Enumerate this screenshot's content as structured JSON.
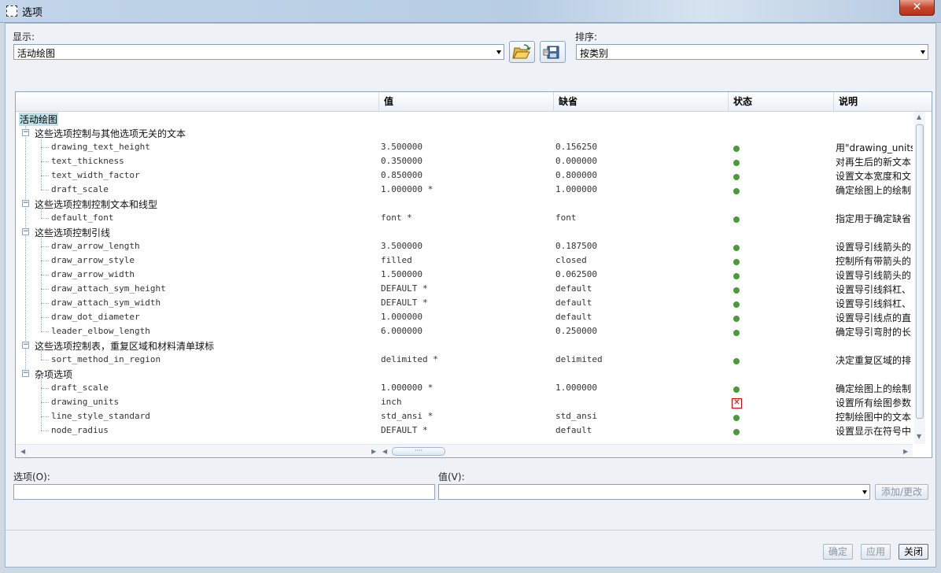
{
  "window": {
    "title": "选项",
    "close_glyph": "✕"
  },
  "display": {
    "label": "显示:",
    "value": "活动绘图"
  },
  "sort": {
    "label": "排序:",
    "value": "按类别"
  },
  "toolbar": {
    "open_icon": "folder-open-icon",
    "save_icon": "save-config-icon"
  },
  "table": {
    "columns": [
      "",
      "值",
      "缺省",
      "状态",
      "说明"
    ],
    "root": "活动绘图",
    "rows": [
      {
        "type": "group",
        "name": "这些选项控制与其他选项无关的文本"
      },
      {
        "type": "item",
        "name": "drawing_text_height",
        "value": "3.500000",
        "default": "0.156250",
        "status": "ok",
        "desc": "用\"drawing_units\""
      },
      {
        "type": "item",
        "name": "text_thickness",
        "value": "0.350000",
        "default": "0.000000",
        "status": "ok",
        "desc": "对再生后的新文本"
      },
      {
        "type": "item",
        "name": "text_width_factor",
        "value": "0.850000",
        "default": "0.800000",
        "status": "ok",
        "desc": "设置文本宽度和文"
      },
      {
        "type": "item",
        "name": "draft_scale",
        "value": "1.000000 *",
        "default": "1.000000",
        "status": "ok",
        "desc": "确定绘图上的绘制"
      },
      {
        "type": "group",
        "name": "这些选项控制控制文本和线型"
      },
      {
        "type": "item",
        "name": "default_font",
        "value": "font *",
        "default": "font",
        "status": "ok",
        "desc": "指定用于确定缺省"
      },
      {
        "type": "group",
        "name": "这些选项控制引线"
      },
      {
        "type": "item",
        "name": "draw_arrow_length",
        "value": "3.500000",
        "default": "0.187500",
        "status": "ok",
        "desc": "设置导引线箭头的"
      },
      {
        "type": "item",
        "name": "draw_arrow_style",
        "value": "filled",
        "default": "closed",
        "status": "ok",
        "desc": "控制所有带箭头的"
      },
      {
        "type": "item",
        "name": "draw_arrow_width",
        "value": "1.500000",
        "default": "0.062500",
        "status": "ok",
        "desc": "设置导引线箭头的"
      },
      {
        "type": "item",
        "name": "draw_attach_sym_height",
        "value": "DEFAULT *",
        "default": "default",
        "status": "ok",
        "desc": "设置导引线斜杠、"
      },
      {
        "type": "item",
        "name": "draw_attach_sym_width",
        "value": "DEFAULT *",
        "default": "default",
        "status": "ok",
        "desc": "设置导引线斜杠、"
      },
      {
        "type": "item",
        "name": "draw_dot_diameter",
        "value": "1.000000",
        "default": "default",
        "status": "ok",
        "desc": "设置导引线点的直"
      },
      {
        "type": "item",
        "name": "leader_elbow_length",
        "value": "6.000000",
        "default": "0.250000",
        "status": "ok",
        "desc": "确定导引弯肘的长"
      },
      {
        "type": "group",
        "name": "这些选项控制表，重复区域和材料清单球标"
      },
      {
        "type": "item",
        "name": "sort_method_in_region",
        "value": "delimited *",
        "default": "delimited",
        "status": "ok",
        "desc": "决定重复区域的排"
      },
      {
        "type": "group",
        "name": "杂项选项"
      },
      {
        "type": "item",
        "name": "draft_scale",
        "value": "1.000000 *",
        "default": "1.000000",
        "status": "ok",
        "desc": "确定绘图上的绘制"
      },
      {
        "type": "item",
        "name": "drawing_units",
        "value": "inch",
        "default": "",
        "status": "error",
        "desc": "设置所有绘图参数"
      },
      {
        "type": "item",
        "name": "line_style_standard",
        "value": "std_ansi *",
        "default": "std_ansi",
        "status": "ok",
        "desc": "控制绘图中的文本"
      },
      {
        "type": "item",
        "name": "node_radius",
        "value": "DEFAULT *",
        "default": "default",
        "status": "ok",
        "desc": "设置显示在符号中"
      }
    ]
  },
  "option_field": {
    "label": "选项(O):",
    "value": ""
  },
  "value_field": {
    "label": "值(V):",
    "value": ""
  },
  "buttons": {
    "add_change": "添加/更改",
    "ok": "确定",
    "apply": "应用",
    "close": "关闭"
  },
  "status_colors": {
    "ok": "#4a9a3a",
    "error": "#dd0000"
  }
}
